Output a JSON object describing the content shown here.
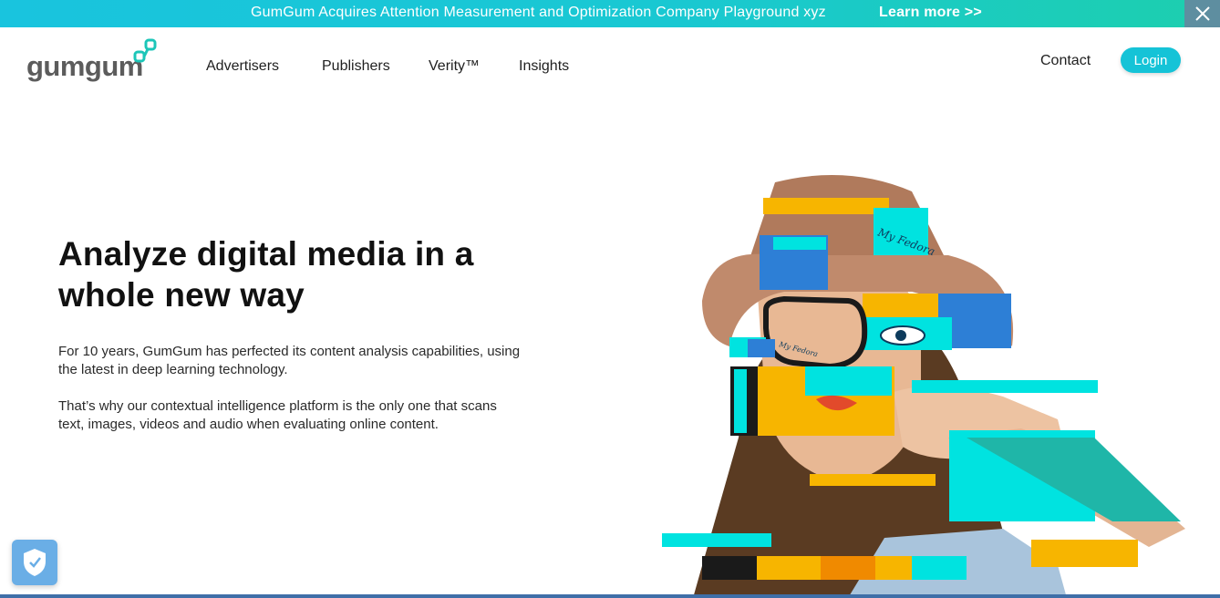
{
  "announcement": {
    "message": "GumGum Acquires Attention Measurement and Optimization Company Playground xyz",
    "link": "Learn more >>",
    "close_icon": "close-icon"
  },
  "header": {
    "logo_text": "gumgum",
    "nav": [
      "Advertisers",
      "Publishers",
      "Verity™",
      "Insights"
    ],
    "contact": "Contact",
    "login": "Login"
  },
  "hero": {
    "title": "Analyze digital media in a whole new way",
    "paragraph1": "For 10 years, GumGum has perfected its content analysis capabilities, using the latest in deep learning technology.",
    "paragraph2": "That’s why our contextual intelligence platform is the only one that scans text, images, videos and audio when evaluating online content.",
    "hat_text_1": "My Fedora",
    "hat_text_2": "My Fedora"
  },
  "widgets": {
    "privacy_icon": "shield-check-icon"
  },
  "colors": {
    "brand_teal": "#15c3d7",
    "accent_yellow": "#f7b500",
    "accent_cyan": "#00e3e0",
    "accent_blue": "#2d7fd6"
  }
}
